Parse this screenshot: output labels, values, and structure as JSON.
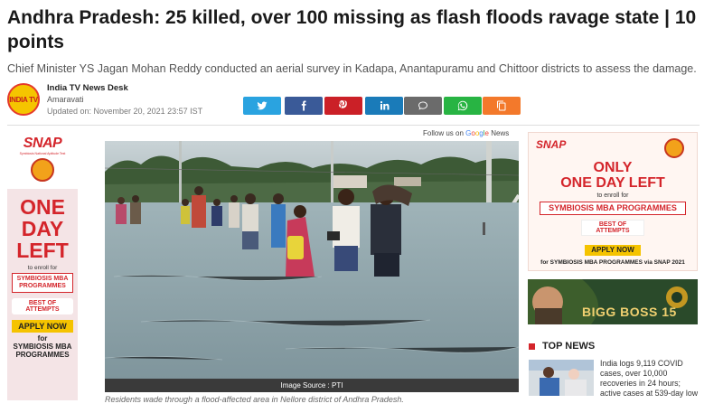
{
  "article": {
    "headline": "Andhra Pradesh: 25 killed, over 100 missing as flash floods ravage state | 10 points",
    "summary": "Chief Minister YS Jagan Mohan Reddy conducted an aerial survey in Kadapa, Anantapuramu and Chittoor districts to assess the damage.",
    "author": "India TV News Desk",
    "location": "Amaravati",
    "updated": "Updated on: November 20, 2021 23:57 IST",
    "image_source": "Image Source : PTI",
    "caption": "Residents wade through a flood-affected area in Nellore district of Andhra Pradesh."
  },
  "logo_text": "INDIA TV",
  "follow": {
    "prefix": "Follow us on",
    "g1": "G",
    "g2": "o",
    "g3": "o",
    "g4": "g",
    "g5": "l",
    "g6": "e",
    "suffix": "News"
  },
  "share_buttons": [
    {
      "name": "twitter",
      "icon": "twitter-icon",
      "color": "#2aa3e0"
    },
    {
      "name": "facebook",
      "icon": "facebook-icon",
      "color": "#3a5a98"
    },
    {
      "name": "pinterest",
      "icon": "pinterest-icon",
      "color": "#cb2027"
    },
    {
      "name": "linkedin",
      "icon": "linkedin-icon",
      "color": "#1a7bb9"
    },
    {
      "name": "comment",
      "icon": "comment-icon",
      "color": "#6b6b6b"
    },
    {
      "name": "whatsapp",
      "icon": "whatsapp-icon",
      "color": "#28b443"
    },
    {
      "name": "copy",
      "icon": "copy-link-icon",
      "color": "#f3792b"
    }
  ],
  "left_ad": {
    "brand": "SNAP",
    "brand_sub": "Symbiosis National Aptitude Test",
    "line1": "ONE",
    "line2": "DAY",
    "line3": "LEFT",
    "enroll": "to enroll for",
    "program": "SYMBIOSIS MBA PROGRAMMES",
    "best": "BEST OF",
    "attempts": "ATTEMPTS",
    "apply": "APPLY NOW",
    "for": "for",
    "program2": "SYMBIOSIS MBA PROGRAMMES"
  },
  "right_ad": {
    "brand": "SNAP",
    "headline1": "ONLY",
    "headline2": "ONE DAY LEFT",
    "enroll": "to enroll for",
    "program": "SYMBIOSIS MBA PROGRAMMES",
    "best": "BEST OF",
    "attempts": "ATTEMPTS",
    "apply": "APPLY NOW",
    "footer": "for SYMBIOSIS MBA PROGRAMMES via SNAP 2021"
  },
  "bigg_boss": {
    "title": "BIGG BOSS 15"
  },
  "top_news": {
    "heading": "TOP NEWS",
    "items": [
      {
        "text": "India logs 9,119 COVID cases, over 10,000 recoveries in 24 hours; active cases at 539-day low"
      }
    ]
  },
  "colors": {
    "accent_red": "#d4252b",
    "headline": "#1a1a1a"
  }
}
